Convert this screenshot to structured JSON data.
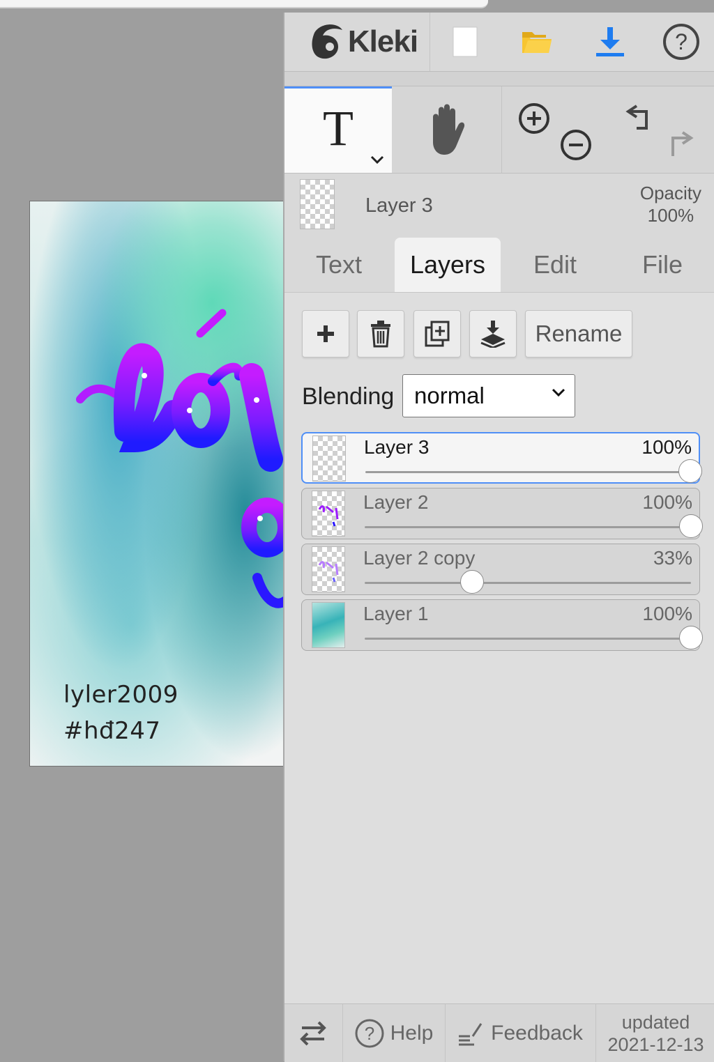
{
  "app": {
    "name": "Kleki"
  },
  "header": {
    "icons": [
      "new-image-icon",
      "open-folder-icon",
      "download-icon",
      "help-icon"
    ]
  },
  "tools": {
    "active": "Text",
    "text_tool_glyph": "T"
  },
  "current_layer": {
    "name": "Layer 3",
    "opacity_label": "Opacity",
    "opacity_value": "100%"
  },
  "tabs": [
    {
      "label": "Text",
      "active": false
    },
    {
      "label": "Layers",
      "active": true
    },
    {
      "label": "Edit",
      "active": false
    },
    {
      "label": "File",
      "active": false
    }
  ],
  "layer_actions": {
    "rename_label": "Rename"
  },
  "blending": {
    "label": "Blending",
    "value": "normal"
  },
  "layers": [
    {
      "name": "Layer 3",
      "opacity_label": "100%",
      "opacity": 1.0,
      "selected": true
    },
    {
      "name": "Layer 2",
      "opacity_label": "100%",
      "opacity": 1.0,
      "selected": false
    },
    {
      "name": "Layer 2 copy",
      "opacity_label": "33%",
      "opacity": 0.33,
      "selected": false
    },
    {
      "name": "Layer 1",
      "opacity_label": "100%",
      "opacity": 1.0,
      "selected": false
    }
  ],
  "canvas": {
    "signature_line1": "lyler2009",
    "signature_line2": "#hđ247"
  },
  "footer": {
    "help_label": "Help",
    "feedback_label": "Feedback",
    "updated_label": "updated",
    "updated_date": "2021-12-13"
  },
  "colors": {
    "accent": "#4f8ff7",
    "panel_bg": "#dedede",
    "workspace_bg": "#9e9e9e",
    "text_purple": "#b616ff",
    "text_blue": "#2a18ff"
  }
}
